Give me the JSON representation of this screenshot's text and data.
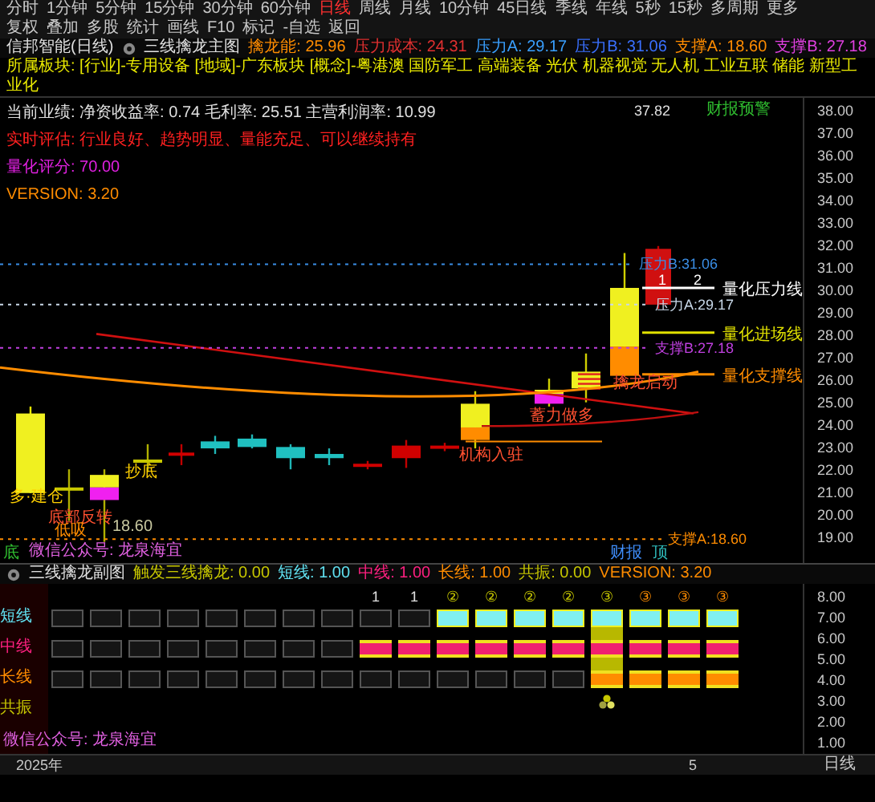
{
  "toolbar": {
    "tabs": [
      {
        "label": "分时",
        "selected": false
      },
      {
        "label": "1分钟",
        "selected": false
      },
      {
        "label": "5分钟",
        "selected": false
      },
      {
        "label": "15分钟",
        "selected": false
      },
      {
        "label": "30分钟",
        "selected": false
      },
      {
        "label": "60分钟",
        "selected": false
      },
      {
        "label": "日线",
        "selected": true
      },
      {
        "label": "周线",
        "selected": false
      },
      {
        "label": "月线",
        "selected": false
      },
      {
        "label": "10分钟",
        "selected": false
      },
      {
        "label": "45日线",
        "selected": false
      },
      {
        "label": "季线",
        "selected": false
      },
      {
        "label": "年线",
        "selected": false
      },
      {
        "label": "5秒",
        "selected": false
      },
      {
        "label": "15秒",
        "selected": false
      },
      {
        "label": "多周期",
        "selected": false
      },
      {
        "label": "更多",
        "selected": false
      }
    ],
    "tools": [
      "复权",
      "叠加",
      "多股",
      "统计",
      "画线",
      "F10",
      "标记",
      "-自选",
      "返回"
    ]
  },
  "title_bar": {
    "stock": "信邦智能(日线)",
    "indicator": "三线擒龙主图",
    "values": [
      {
        "label": "擒龙能: 25.96",
        "color": "#ff8c00"
      },
      {
        "label": "压力成本: 24.31",
        "color": "#e03030"
      },
      {
        "label": "压力A: 29.17",
        "color": "#3aa0ff"
      },
      {
        "label": "压力B: 31.06",
        "color": "#3a70ff"
      },
      {
        "label": "支撑A: 18.60",
        "color": "#ff8c00"
      },
      {
        "label": "支撑B: 27.18",
        "color": "#e040e0"
      }
    ]
  },
  "sector_line": "所属板块: [行业]-专用设备 [地域]-广东板块 [概念]-粤港澳 国防军工 高端装备 光伏 机器视觉 无人机 工业互联 储能 新型工业化",
  "main_chart": {
    "info_lines": [
      {
        "text": "当前业绩: 净资收益率: 0.74 毛利率: 25.51 主营利润率: 10.99",
        "color": "#e0e0e0"
      },
      {
        "text": "实时评估: 行业良好、趋势明显、量能充足、可以继续持有",
        "color": "#ff2020"
      },
      {
        "text": "量化评分: 70.00",
        "color": "#e020e0"
      },
      {
        "text": "VERSION: 3.20",
        "color": "#ff8c00"
      }
    ],
    "corner_note": "财报预警",
    "corner_price": "37.82",
    "price_lines": [
      {
        "label": "压力B:31.06",
        "color": "#3a8ee6"
      },
      {
        "label": "压力A:29.17",
        "color": "#c8d8e8"
      },
      {
        "label": "支撑B:27.18",
        "color": "#c040e0"
      },
      {
        "label": "支撑A:18.60",
        "color": "#ff8c00"
      }
    ],
    "quant_lines": [
      {
        "label": "量化压力线",
        "color": "#ffffff"
      },
      {
        "label": "量化进场线",
        "color": "#e0e000"
      },
      {
        "label": "量化支撑线",
        "color": "#ff8c00"
      }
    ],
    "quant_marks": [
      "1",
      "2"
    ],
    "annotations": [
      {
        "text": "多·建仓",
        "color": "#ffd000"
      },
      {
        "text": "底部反转",
        "color": "#ff5030"
      },
      {
        "text": "抄底",
        "color": "#ffd000"
      },
      {
        "text": "低吸",
        "color": "#ff8c00"
      },
      {
        "text": "18.60",
        "color": "#c8c8a0"
      },
      {
        "text": "机构入驻",
        "color": "#ff5030"
      },
      {
        "text": "蓄力做多",
        "color": "#ff5030"
      },
      {
        "text": "擒龙启动",
        "color": "#ff5030"
      },
      {
        "text": "底",
        "color": "#30c030"
      },
      {
        "text": "财报",
        "color": "#4090ff"
      },
      {
        "text": "顶",
        "color": "#30c0c0"
      }
    ],
    "footer": "微信公众号: 龙泉海宜",
    "yticks": [
      "38.00",
      "37.00",
      "36.00",
      "35.00",
      "34.00",
      "33.00",
      "32.00",
      "31.00",
      "30.00",
      "29.00",
      "28.00",
      "27.00",
      "26.00",
      "25.00",
      "24.00",
      "23.00",
      "22.00",
      "21.00",
      "20.00",
      "19.00"
    ]
  },
  "sub_chart": {
    "title": "三线擒龙副图",
    "values": [
      {
        "label": "触发三线擒龙: 0.00",
        "color": "#c8c800"
      },
      {
        "label": "短线: 1.00",
        "color": "#60e0f0"
      },
      {
        "label": "中线: 1.00",
        "color": "#ff2080"
      },
      {
        "label": "长线: 1.00",
        "color": "#ff8c00"
      },
      {
        "label": "共振: 0.00",
        "color": "#c8c800"
      },
      {
        "label": "VERSION: 3.20",
        "color": "#ff8c00"
      }
    ],
    "row_labels": [
      {
        "label": "短线",
        "color": "#60e0f0"
      },
      {
        "label": "中线",
        "color": "#ff2080"
      },
      {
        "label": "长线",
        "color": "#ff8c00"
      },
      {
        "label": "共振",
        "color": "#c8c800"
      }
    ],
    "columns": [
      {
        "short": false,
        "mid": false,
        "long": false,
        "resonance": false
      },
      {
        "short": false,
        "mid": false,
        "long": false,
        "resonance": false
      },
      {
        "short": false,
        "mid": false,
        "long": false,
        "resonance": false
      },
      {
        "short": false,
        "mid": false,
        "long": false,
        "resonance": false
      },
      {
        "short": false,
        "mid": false,
        "long": false,
        "resonance": false
      },
      {
        "short": false,
        "mid": false,
        "long": false,
        "resonance": false
      },
      {
        "short": false,
        "mid": false,
        "long": false,
        "resonance": false
      },
      {
        "short": false,
        "mid": false,
        "long": false,
        "resonance": false
      },
      {
        "marker": {
          "text": "1",
          "color": "#e0e0e0"
        },
        "short": false,
        "mid": true,
        "long": false,
        "resonance": false
      },
      {
        "marker": {
          "text": "1",
          "color": "#e0e0e0"
        },
        "short": false,
        "mid": true,
        "long": false,
        "resonance": false
      },
      {
        "marker": {
          "text": "②",
          "color": "#c8c800"
        },
        "short": true,
        "mid": true,
        "long": false,
        "resonance": false
      },
      {
        "marker": {
          "text": "②",
          "color": "#c8c800"
        },
        "short": true,
        "mid": true,
        "long": false,
        "resonance": false
      },
      {
        "marker": {
          "text": "②",
          "color": "#c8c800"
        },
        "short": true,
        "mid": true,
        "long": false,
        "resonance": false
      },
      {
        "marker": {
          "text": "②",
          "color": "#c8c800"
        },
        "short": true,
        "mid": true,
        "long": false,
        "resonance": false
      },
      {
        "marker": {
          "text": "③",
          "color": "#c8c800"
        },
        "short": true,
        "mid": true,
        "long": true,
        "resonance": true
      },
      {
        "marker": {
          "text": "③",
          "color": "#ff8c00"
        },
        "short": true,
        "mid": true,
        "long": true,
        "resonance": false
      },
      {
        "marker": {
          "text": "③",
          "color": "#ff8c00"
        },
        "short": true,
        "mid": true,
        "long": true,
        "resonance": false
      },
      {
        "marker": {
          "text": "③",
          "color": "#ff8c00"
        },
        "short": true,
        "mid": true,
        "long": true,
        "resonance": false
      }
    ],
    "footer": "微信公众号: 龙泉海宜",
    "yticks": [
      "8.00",
      "7.00",
      "6.00",
      "5.00",
      "4.00",
      "3.00",
      "2.00",
      "1.00"
    ]
  },
  "time_axis": {
    "year": "2025年",
    "month": "5",
    "period": "日线"
  }
}
